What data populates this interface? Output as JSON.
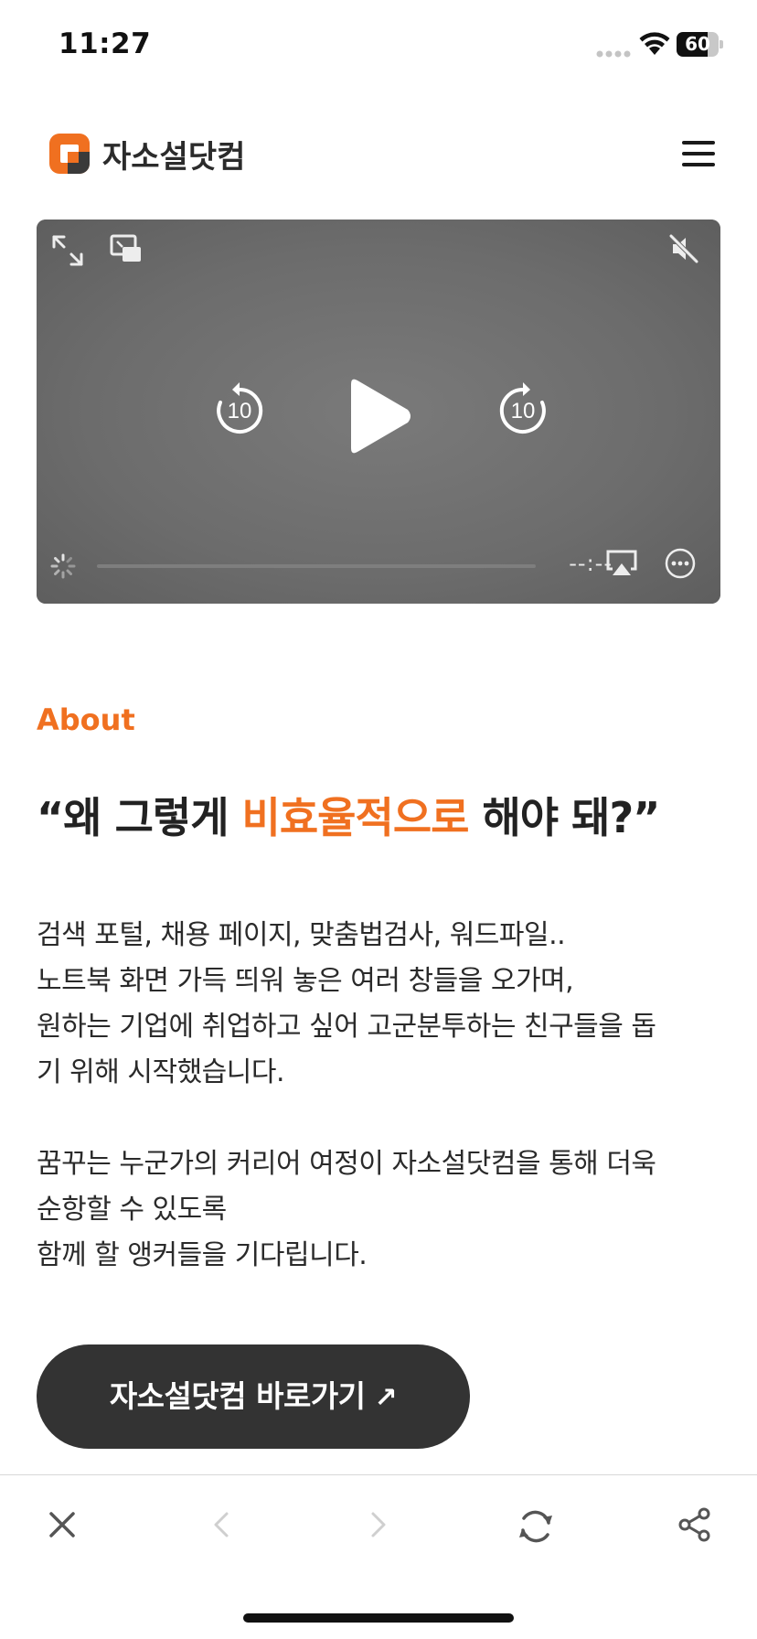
{
  "status_bar": {
    "time": "11:27",
    "battery_level": "60"
  },
  "header": {
    "logo_text": "자소설닷컴",
    "brand_color": "#f07020"
  },
  "video": {
    "skip_back_seconds": "10",
    "skip_forward_seconds": "10",
    "time_display": "--:--"
  },
  "about": {
    "eyebrow": "About",
    "headline_prefix": "“왜 그렇게 ",
    "headline_accent": "비효율적으로",
    "headline_suffix": " 해야 돼?”",
    "paragraph_1": [
      "검색 포털, 채용 페이지, 맞춤법검사, 워드파일..",
      "노트북 화면 가득 띄워 놓은 여러 창들을 오가며,",
      "원하는 기업에 취업하고 싶어 고군분투하는 친구들을 돕",
      "기 위해 시작했습니다."
    ],
    "paragraph_2": [
      "꿈꾸는 누군가의 커리어 여정이 자소설닷컴을 통해 더욱",
      "순항할 수 있도록",
      "함께 할 앵커들을 기다립니다."
    ],
    "cta_label": "자소설닷컴 바로가기",
    "cta_arrow": "↗"
  },
  "browser_toolbar": {
    "icons": [
      "close-icon",
      "back-icon",
      "forward-icon",
      "reload-icon",
      "share-icon"
    ]
  }
}
